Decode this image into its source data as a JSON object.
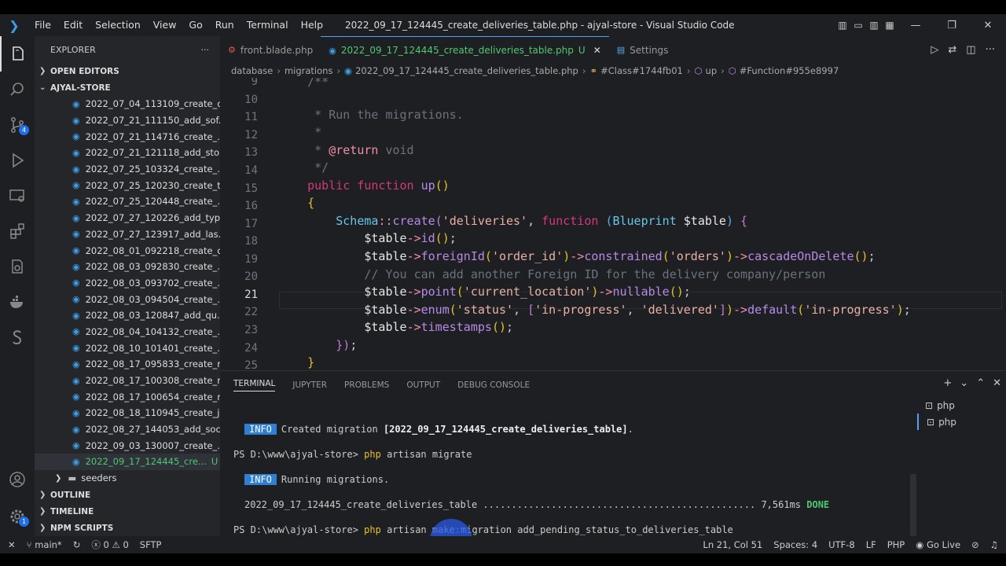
{
  "menu": [
    "File",
    "Edit",
    "Selection",
    "View",
    "Go",
    "Run",
    "Terminal",
    "Help"
  ],
  "window_title": "2022_09_17_124445_create_deliveries_table.php - ajyal-store - Visual Studio Code",
  "activity": {
    "scm_badge": "4",
    "settings_badge": "1"
  },
  "explorer": {
    "title": "EXPLORER",
    "open_editors": "OPEN EDITORS",
    "project": "AJYAL-STORE",
    "files": [
      "2022_07_04_113109_create_c...",
      "2022_07_21_111150_add_sof...",
      "2022_07_21_114716_create_...",
      "2022_07_21_121118_add_sto...",
      "2022_07_25_103324_create_...",
      "2022_07_25_120230_create_t...",
      "2022_07_25_120448_create_...",
      "2022_07_27_120226_add_typ...",
      "2022_07_27_123917_add_las...",
      "2022_08_01_092218_create_c...",
      "2022_08_03_092830_create_...",
      "2022_08_03_093702_create_...",
      "2022_08_03_094504_create_...",
      "2022_08_03_120847_add_qu...",
      "2022_08_04_104132_create_...",
      "2022_08_10_101401_create_...",
      "2022_08_17_095833_create_r...",
      "2022_08_17_100308_create_r...",
      "2022_08_17_100654_create_r...",
      "2022_08_18_110945_create_j...",
      "2022_08_27_144053_add_soc...",
      "2022_09_03_130007_create_..."
    ],
    "selected_file": "2022_09_17_124445_cre...",
    "selected_status": "U",
    "seeders": "seeders",
    "outline": "OUTLINE",
    "timeline": "TIMELINE",
    "npm": "NPM SCRIPTS"
  },
  "tabs": [
    {
      "label": "front.blade.php"
    },
    {
      "label": "2022_09_17_124445_create_deliveries_table.php",
      "status": "U"
    },
    {
      "label": "Settings"
    }
  ],
  "breadcrumb": [
    "database",
    "migrations",
    "2022_09_17_124445_create_deliveries_table.php",
    "#Class#1744fb01",
    "up",
    "#Function#955e8997"
  ],
  "line_numbers": [
    "9",
    "10",
    "11",
    "12",
    "13",
    "14",
    "15",
    "16",
    "17",
    "18",
    "19",
    "20",
    "21",
    "22",
    "23",
    "24",
    "25"
  ],
  "current_line": "21",
  "panel_tabs": [
    "TERMINAL",
    "JUPYTER",
    "PROBLEMS",
    "OUTPUT",
    "DEBUG CONSOLE"
  ],
  "terminal": {
    "info1_tag": "INFO",
    "info1_text": "Created migration ",
    "info1_name": "[2022_09_17_124445_create_deliveries_table]",
    "info1_end": ".",
    "prompt1": "PS D:\\www\\ajyal-store> ",
    "cmd1_a": "php",
    " cmd1_b": "",
    "cmd1_rest": " artisan migrate",
    "info2_tag": "INFO",
    "info2_text": "Running migrations.",
    "migration_line": "2022_09_17_124445_create_deliveries_table ................................................ 7,561ms ",
    "done": "DONE",
    "prompt2": "PS D:\\www\\ajyal-store> ",
    "cmd2_a": "php",
    "cmd2_rest": " artisan make:migration add_pending_status_to_deliveries_table",
    "instances": [
      "php",
      "php"
    ]
  },
  "status": {
    "branch": "main*",
    "errors": "0",
    "warnings": "0",
    "sftp": "SFTP",
    "position": "Ln 21, Col 51",
    "spaces": "Spaces: 4",
    "encoding": "UTF-8",
    "eol": "LF",
    "lang": "PHP",
    "golive": "Go Live"
  }
}
